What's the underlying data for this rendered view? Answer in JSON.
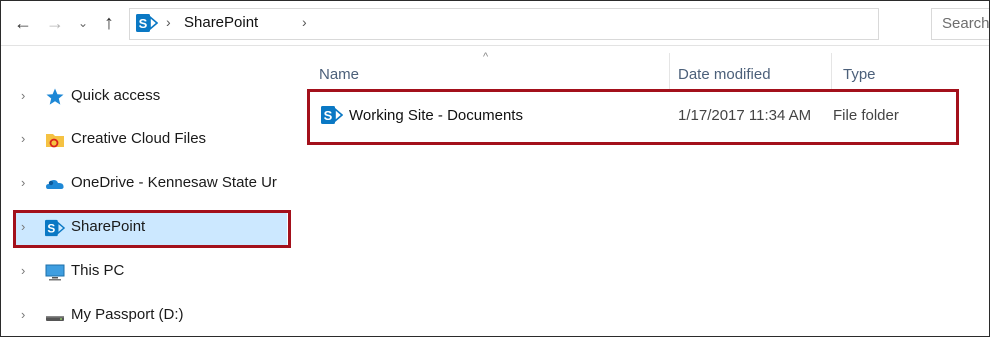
{
  "nav": {
    "back_icon": "arrow-left-icon",
    "forward_icon": "arrow-right-icon",
    "recent_icon": "chevron-down-icon",
    "up_icon": "arrow-up-icon",
    "glyphs": {
      "back": "←",
      "forward": "→",
      "recent": "⌄",
      "up": "↑"
    }
  },
  "address_bar": {
    "sep": "›",
    "crumb": "SharePoint",
    "dropdown": "⌄",
    "refresh": "↻"
  },
  "search": {
    "placeholder": "Search"
  },
  "sidebar": {
    "chevron": "›",
    "items": [
      {
        "label": "Quick access",
        "icon": "star-icon"
      },
      {
        "label": "Creative Cloud Files",
        "icon": "creative-cloud-folder-icon"
      },
      {
        "label": "OneDrive - Kennesaw State Ur",
        "icon": "onedrive-icon"
      },
      {
        "label": "SharePoint",
        "icon": "sharepoint-icon"
      },
      {
        "label": "This PC",
        "icon": "computer-icon"
      },
      {
        "label": "My Passport (D:)",
        "icon": "drive-icon"
      }
    ]
  },
  "columns": {
    "name": "Name",
    "date": "Date modified",
    "type": "Type",
    "sort": "^"
  },
  "files": [
    {
      "name": "Working Site - Documents",
      "date": "1/17/2017 11:34 AM",
      "type": "File folder"
    }
  ],
  "colors": {
    "highlight": "#a3101b",
    "selected": "#cce8ff",
    "sharepoint": "#0a78c4"
  }
}
